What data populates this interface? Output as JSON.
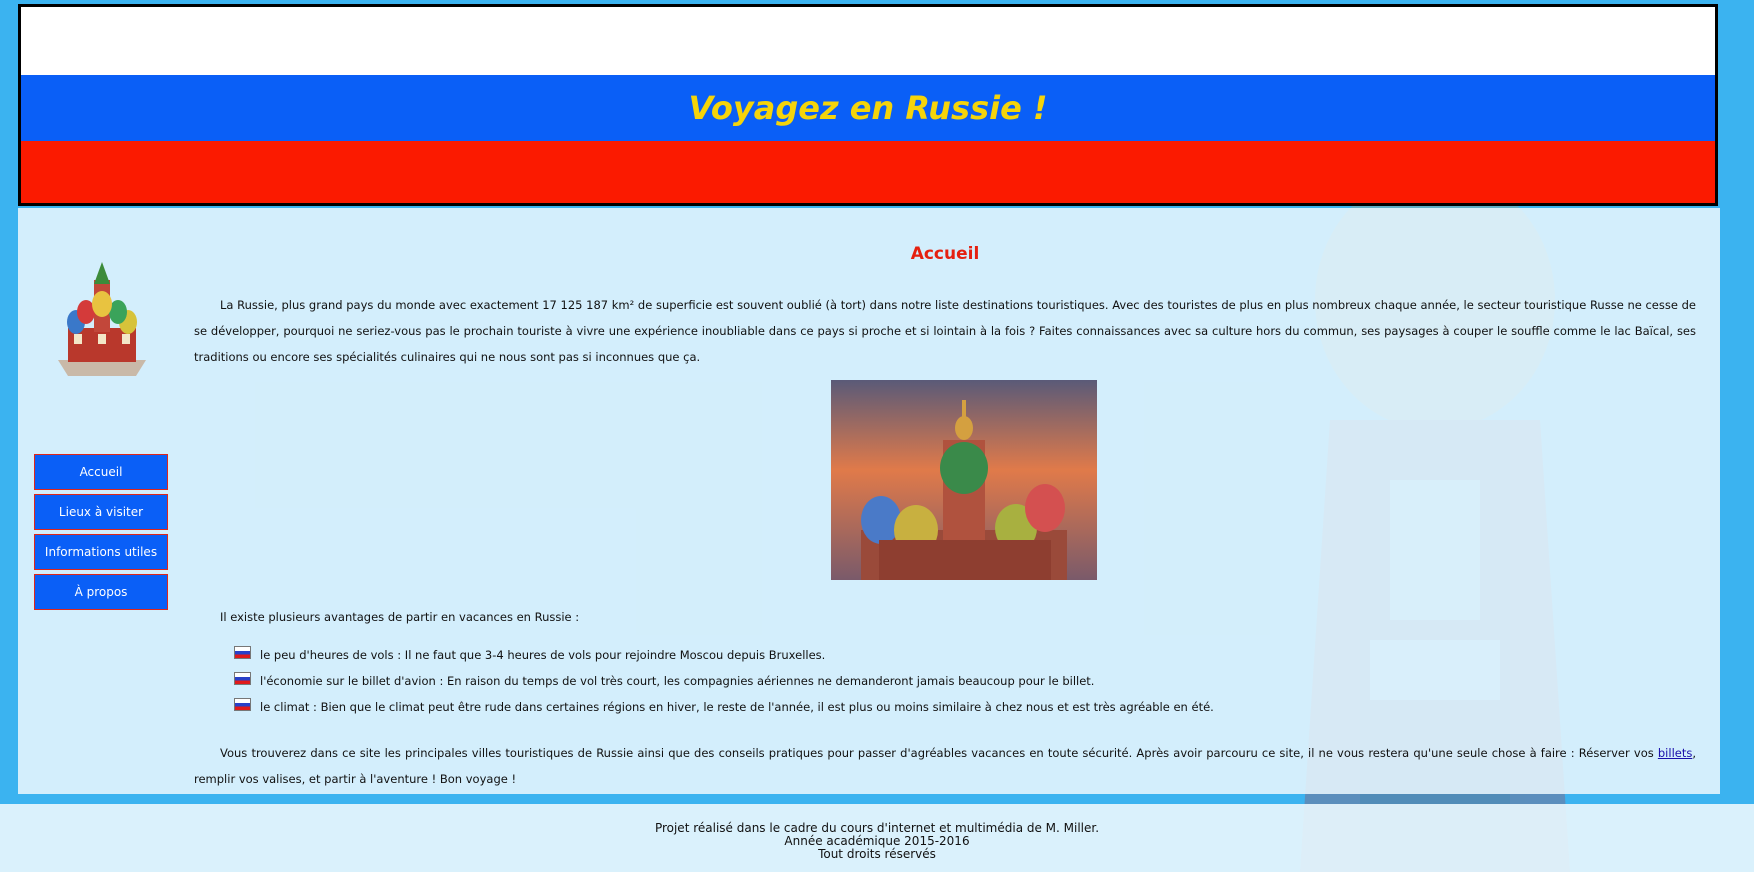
{
  "header": {
    "title": "Voyagez en Russie !"
  },
  "sidebar": {
    "nav": [
      {
        "label": "Accueil"
      },
      {
        "label": "Lieux à visiter"
      },
      {
        "label": "Informations utiles"
      },
      {
        "label": "À propos"
      }
    ]
  },
  "main": {
    "heading": "Accueil",
    "intro": "La Russie, plus grand pays du monde avec exactement 17 125 187 km² de superficie est souvent oublié (à tort) dans notre liste destinations touristiques. Avec des touristes de plus en plus nombreux chaque année, le secteur touristique Russe ne cesse de se développer, pourquoi ne seriez-vous pas le prochain touriste à vivre une expérience inoubliable dans ce pays si proche et si lointain à la fois ? Faites connaissances avec sa culture hors du commun, ses paysages à couper le souffle comme le lac Baïcal, ses traditions ou encore ses spécialités culinaires qui ne nous sont pas si inconnues que ça.",
    "advantages_intro": "Il existe plusieurs avantages de partir en vacances en Russie :",
    "advantages": [
      {
        "text": "le peu d'heures de vols : Il ne faut que 3-4 heures de vols pour rejoindre Moscou depuis Bruxelles."
      },
      {
        "text": "l'économie sur le billet d'avion : En raison du temps de vol très court, les compagnies aériennes ne demanderont jamais beaucoup pour le billet."
      },
      {
        "text": "le climat : Bien que le climat peut être rude dans certaines régions en hiver, le reste de l'année, il est plus ou moins similaire à chez nous et est très agréable en été."
      }
    ],
    "outro_before": "Vous trouverez dans ce site les principales villes touristiques de Russie ainsi que des conseils pratiques pour passer d'agréables vacances en toute sécurité. Après avoir parcouru ce site, il ne vous restera qu'une seule chose à faire : Réserver vos ",
    "outro_link": "billets",
    "outro_after": ", remplir vos valises, et partir à l'aventure ! Bon voyage !"
  },
  "footer": {
    "line1": "Projet réalisé dans le cadre du cours d'internet et multimédia de M. Miller.",
    "line2": "Année académique 2015-2016",
    "line3": "Tout droits réservés"
  },
  "colors": {
    "flag_white": "#ffffff",
    "flag_blue": "#0a5ff7",
    "flag_red": "#fb1a00",
    "title_yellow": "#f5d40a",
    "heading_red": "#e5200f",
    "page_bg": "#3bb3f0"
  }
}
